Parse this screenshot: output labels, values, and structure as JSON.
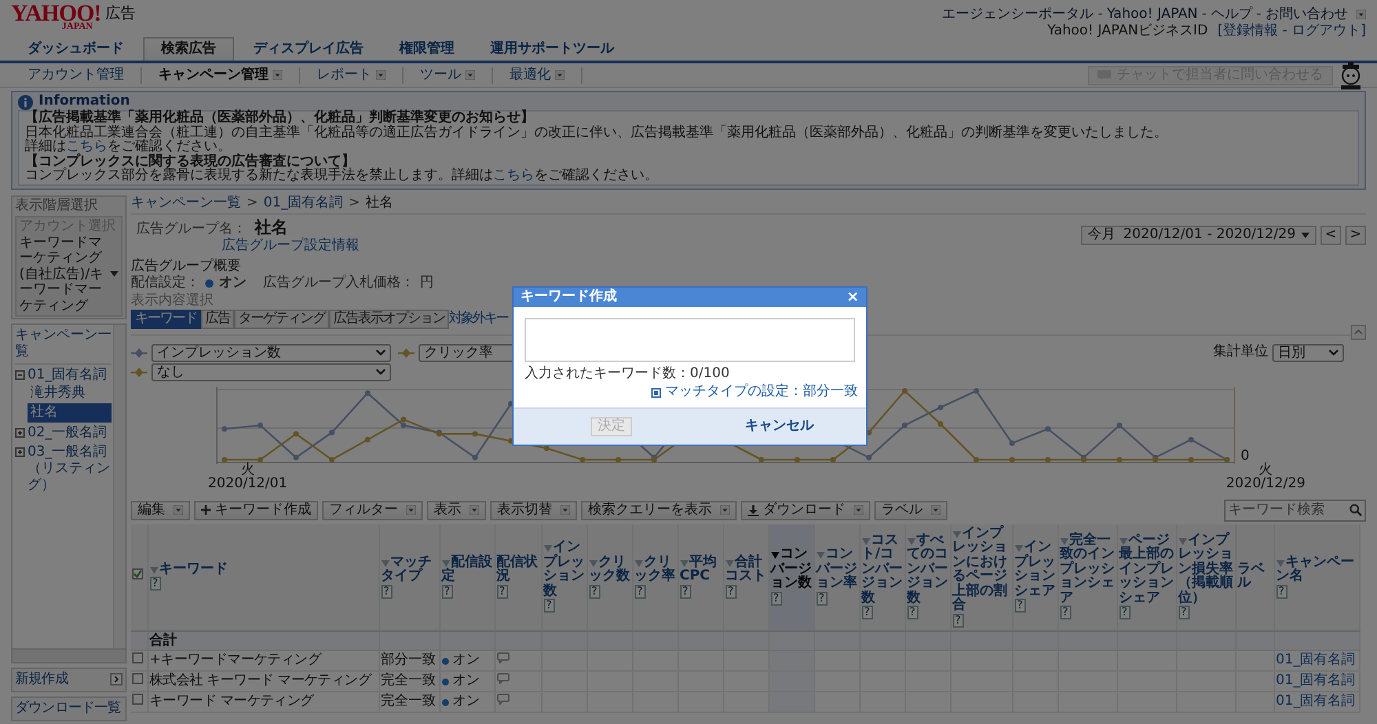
{
  "header": {
    "logo": "YAHOO!",
    "logo_sub": "JAPAN",
    "product": "広告",
    "links": [
      "エージェンシーポータル",
      "Yahoo! JAPAN",
      "ヘルプ",
      "お問い合わせ"
    ],
    "separator": "-",
    "business_id_label": "Yahoo! JAPANビジネスID",
    "account_links": "[登録情報 - ログアウト]"
  },
  "main_tabs": [
    {
      "label": "ダッシュボード",
      "selected": false
    },
    {
      "label": "検索広告",
      "selected": true
    },
    {
      "label": "ディスプレイ広告",
      "selected": false
    },
    {
      "label": "権限管理",
      "selected": false
    },
    {
      "label": "運用サポートツール",
      "selected": false
    }
  ],
  "sub_nav": [
    {
      "label": "アカウント管理",
      "dropdown": false,
      "selected": false
    },
    {
      "label": "キャンペーン管理",
      "dropdown": true,
      "selected": true
    },
    {
      "label": "レポート",
      "dropdown": true,
      "selected": false
    },
    {
      "label": "ツール",
      "dropdown": true,
      "selected": false
    },
    {
      "label": "最適化",
      "dropdown": true,
      "selected": false
    }
  ],
  "chat_button": {
    "label": "チャットで担当者に問い合わせる",
    "disabled": true
  },
  "info": {
    "title": "Information",
    "lines": [
      {
        "kind": "heading",
        "text": "【広告掲載基準「薬用化粧品（医薬部外品）、化粧品」判断基準変更のお知らせ】"
      },
      {
        "kind": "text",
        "text": "日本化粧品工業連合会（粧工連）の自主基準「化粧品等の適正広告ガイドライン」の改正に伴い、広告掲載基準「薬用化粧品（医薬部外品）、化粧品」の判断基準を変更いたしました。"
      },
      {
        "kind": "linked",
        "before": "詳細は",
        "link": "こちら",
        "after": "をご確認ください。"
      },
      {
        "kind": "heading",
        "text": "【コンプレックスに関する表現の広告審査について】"
      },
      {
        "kind": "linked",
        "before": "コンプレックス部分を露骨に表現する新たな表現手法を禁止します。詳細は",
        "link": "こちら",
        "after": "をご確認ください。"
      }
    ]
  },
  "sidebar": {
    "title": "表示階層選択",
    "account_select": {
      "label": "アカウント選択",
      "value": "キーワードマーケティング(自社広告)/キーワードマーケティング"
    },
    "campaign_tree": {
      "title": "キャンペーン一覧",
      "items": [
        {
          "label": "01_固有名詞",
          "expanded": true,
          "selected": false,
          "children": [
            {
              "label": "滝井秀典",
              "selected": false
            },
            {
              "label": "社名",
              "selected": true
            }
          ]
        },
        {
          "label": "02_一般名詞",
          "expanded": false,
          "selected": false
        },
        {
          "label": "03_一般名詞（リスティング）",
          "expanded": false,
          "selected": false
        }
      ]
    },
    "buttons": [
      {
        "label": "新規作成",
        "kind": "next"
      },
      {
        "label": "ダウンロード一覧",
        "kind": "plain"
      }
    ]
  },
  "breadcrumb": {
    "items": [
      "キャンペーン一覧",
      "01_固有名詞",
      "社名"
    ],
    "separator": ">"
  },
  "date_range": {
    "preset": "今月",
    "range": "2020/12/01 - 2020/12/29",
    "nav": [
      "<",
      ">"
    ]
  },
  "ad_group": {
    "name_label": "広告グループ名：",
    "name": "社名",
    "settings_link": "広告グループ設定情報"
  },
  "summary": {
    "title": "広告グループ概要",
    "delivery_label": "配信設定：",
    "delivery": "オン",
    "delivery_on": true,
    "bid_label": "広告グループ入札価格：",
    "bid_unit": "円"
  },
  "content_tabs": {
    "label": "表示内容選択",
    "tabs": [
      {
        "label": "キーワード",
        "selected": true
      },
      {
        "label": "広告",
        "selected": false
      },
      {
        "label": "ターゲティング",
        "selected": false
      },
      {
        "label": "広告表示オプション",
        "selected": false
      },
      {
        "label": "対象外キー",
        "selected": false,
        "kind": "link"
      }
    ]
  },
  "chart_controls": {
    "metric1": "インプレッション数",
    "metric2": "なし",
    "metric3": "クリック率",
    "unit_label": "集計単位",
    "unit": "日別"
  },
  "chart": {
    "start_day": "火",
    "start_date": "2020/12/01",
    "end_day": "火",
    "end_date": "2020/12/29",
    "zero_label": "0"
  },
  "toolbar": {
    "buttons": [
      {
        "label": "編集",
        "kind": "menu"
      },
      {
        "label": "キーワード作成",
        "kind": "add"
      },
      {
        "label": "フィルター",
        "kind": "menu"
      },
      {
        "label": "表示",
        "kind": "menu"
      },
      {
        "label": "表示切替",
        "kind": "menu"
      },
      {
        "label": "検索クエリーを表示",
        "kind": "menu"
      },
      {
        "label": "ダウンロード",
        "kind": "download"
      },
      {
        "label": "ラベル",
        "kind": "menu"
      }
    ],
    "search_placeholder": "キーワード検索"
  },
  "table": {
    "header_checked": true,
    "columns": [
      {
        "label": "キーワード",
        "sortable": true,
        "help": "?",
        "sorted": false
      },
      {
        "label": "マッチタイプ",
        "sortable": true,
        "help": "?",
        "sorted": false
      },
      {
        "label": "配信設定",
        "sortable": true,
        "help": "?",
        "sorted": false
      },
      {
        "label": "配信状況",
        "sortable": false,
        "help": "?",
        "sorted": false
      },
      {
        "label": "インプレッション数",
        "sortable": true,
        "help": "?",
        "sorted": false
      },
      {
        "label": "クリック数",
        "sortable": true,
        "help": "?",
        "sorted": false
      },
      {
        "label": "クリック率",
        "sortable": true,
        "help": "?",
        "sorted": false
      },
      {
        "label": "平均CPC",
        "sortable": true,
        "help": "?",
        "sorted": false
      },
      {
        "label": "合計コスト",
        "sortable": true,
        "help": "?",
        "sorted": false
      },
      {
        "label": "コンバージョン数",
        "sortable": true,
        "help": "?",
        "sorted": true
      },
      {
        "label": "コンバージョン率",
        "sortable": true,
        "help": "?",
        "sorted": false
      },
      {
        "label": "コスト/コンバージョン数",
        "sortable": true,
        "help": "?",
        "sorted": false
      },
      {
        "label": "すべてのコンバージョン数",
        "sortable": true,
        "help": "?",
        "sorted": false
      },
      {
        "label": "インプレッションにおけるページ上部の割合",
        "sortable": true,
        "help": "?",
        "sorted": false
      },
      {
        "label": "インプレッションシェア",
        "sortable": true,
        "help": "?",
        "sorted": false
      },
      {
        "label": "完全一致のインプレッションシェア",
        "sortable": true,
        "help": "?",
        "sorted": false
      },
      {
        "label": "ページ最上部のインプレッションシェア",
        "sortable": true,
        "help": "?",
        "sorted": false
      },
      {
        "label": "インプレッション損失率（掲載順位）",
        "sortable": true,
        "help": "?",
        "sorted": false
      },
      {
        "label": "ラベル",
        "sortable": false,
        "sorted": false
      },
      {
        "label": "キャンペーン名",
        "sortable": true,
        "help": "?",
        "sorted": false
      }
    ],
    "total_label": "合計",
    "rows": [
      {
        "checked": false,
        "keyword": "+キーワードマーケティング",
        "match": "部分一致",
        "delivery": "オン",
        "delivery_on": true,
        "campaign": "01_固有名詞"
      },
      {
        "checked": false,
        "keyword": "株式会社 キーワード マーケティング",
        "match": "完全一致",
        "delivery": "オン",
        "delivery_on": true,
        "campaign": "01_固有名詞"
      },
      {
        "checked": false,
        "keyword": "キーワード マーケティング",
        "match": "完全一致",
        "delivery": "オン",
        "delivery_on": true,
        "campaign": "01_固有名詞"
      }
    ]
  },
  "dialog": {
    "title": "キーワード作成",
    "close": "×",
    "count_label": "入力されたキーワード数：0/100",
    "match_link": "マッチタイプの設定：部分一致",
    "ok": "決定",
    "ok_disabled": true,
    "cancel": "キャンセル"
  }
}
